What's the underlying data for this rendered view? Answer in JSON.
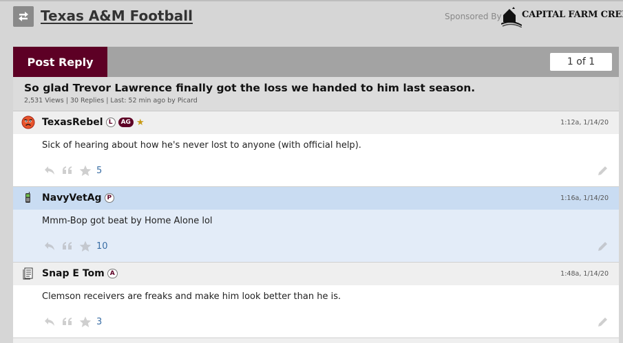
{
  "header": {
    "forum_title": "Texas A&M Football",
    "sponsor_label": "Sponsored By",
    "sponsor_name": "CAPITAL FARM CREDIT"
  },
  "toolbar": {
    "post_reply_label": "Post Reply",
    "page_indicator": "1 of 1"
  },
  "thread": {
    "title": "So glad Trevor Lawrence finally got the loss we handed to him last season.",
    "meta": "2,531 Views | 30 Replies | Last: 52 min ago by Picard"
  },
  "posts": [
    {
      "username": "TexasRebel",
      "badges": [
        "L",
        "AG",
        "★"
      ],
      "avatar_icon": "angry-face-icon",
      "time": "1:12a, 1/14/20",
      "body": "Sick of hearing about how he's never lost to anyone (with official help).",
      "votes": "5"
    },
    {
      "username": "NavyVetAg",
      "badges": [
        "P"
      ],
      "avatar_icon": "phone-icon",
      "time": "1:16a, 1/14/20",
      "body": "Mmm-Bop got beat by Home Alone lol",
      "votes": "10"
    },
    {
      "username": "Snap E Tom",
      "badges": [
        "A"
      ],
      "avatar_icon": "document-icon",
      "time": "1:48a, 1/14/20",
      "body": "Clemson receivers are freaks and make him look better than he is.",
      "votes": "3"
    }
  ],
  "colors": {
    "maroon": "#5d0025",
    "highlight_row": "#e3ecf8",
    "vote_blue": "#3a6ea5"
  }
}
